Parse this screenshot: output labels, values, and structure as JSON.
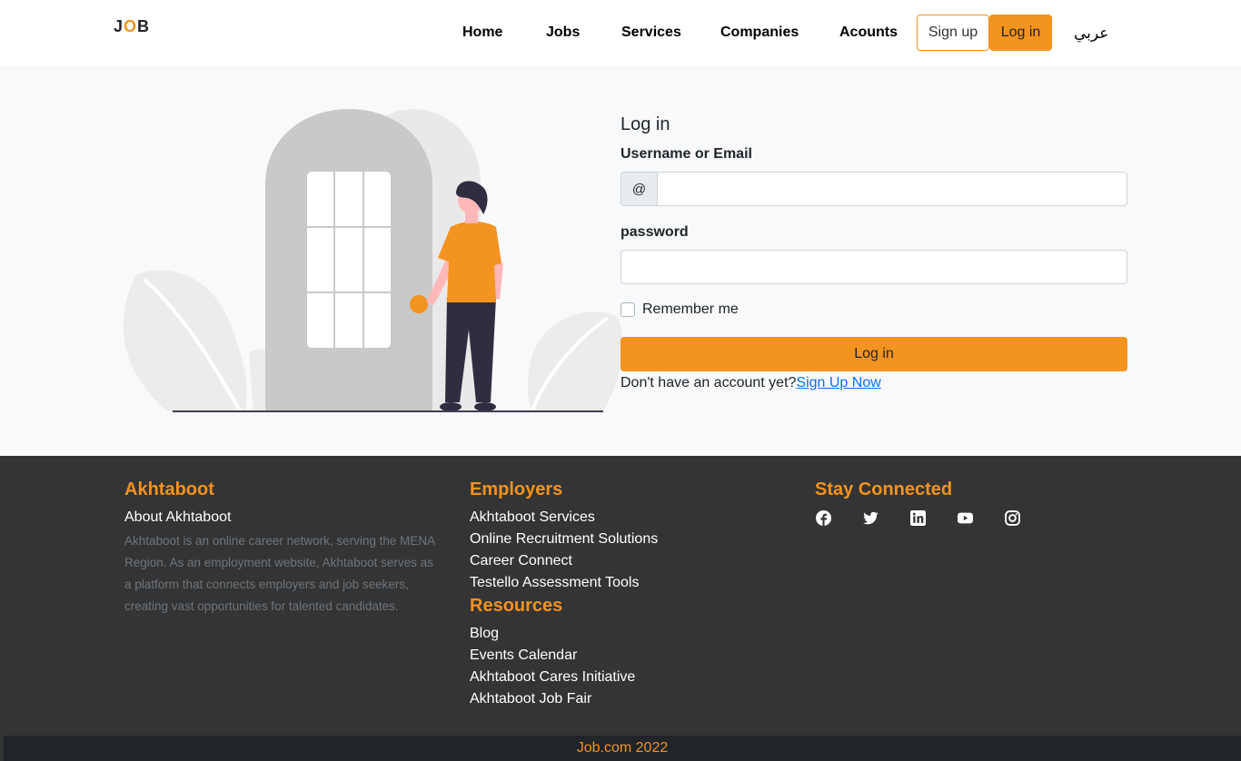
{
  "navbar": {
    "brand_j": "J",
    "brand_o": "O",
    "brand_b": "B",
    "links": [
      "Home",
      "Jobs",
      "Services",
      "Companies",
      "Acounts"
    ],
    "signup_label": "Sign up",
    "login_label": "Log in",
    "language_label": "عربي"
  },
  "login_form": {
    "title": "Log in",
    "username_label": "Username or Email",
    "username_addon": "@",
    "username_value": "",
    "password_label": "password",
    "password_value": "",
    "remember_label": "Remember me",
    "remember_checked": false,
    "submit_label": "Log in",
    "no_account_text": "Don't have an account yet?",
    "signup_link": "Sign Up Now"
  },
  "footer": {
    "about": {
      "heading": "Akhtaboot",
      "subheading": "About Akhtaboot",
      "text": "Akhtaboot is an online career network, serving the MENA Region. As an employment website, Akhtaboot serves as a platform that connects employers and job seekers, creating vast opportunities for talented candidates."
    },
    "employers": {
      "heading": "Employers",
      "links": [
        "Akhtaboot Services",
        "Online Recruitment Solutions",
        "Career Connect",
        "Testello Assessment Tools"
      ]
    },
    "resources": {
      "heading": "Resources",
      "links": [
        "Blog",
        "Events Calendar",
        "Akhtaboot Cares Initiative",
        "Akhtaboot Job Fair"
      ]
    },
    "social": {
      "heading": "Stay Connected",
      "icons": [
        "facebook-icon",
        "twitter-icon",
        "linkedin-icon",
        "youtube-icon",
        "instagram-icon"
      ]
    },
    "copyright": "Job.com 2022"
  },
  "colors": {
    "accent": "#f39320",
    "footer_bg": "#343434",
    "bottom_bar_bg": "#212529",
    "link": "#0d6efd"
  }
}
